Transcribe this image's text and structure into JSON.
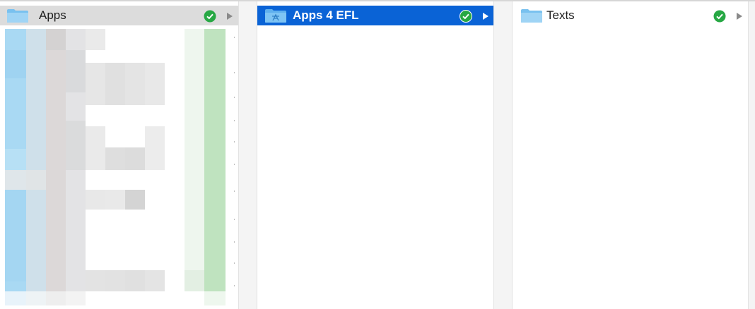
{
  "columns": [
    {
      "folder": {
        "name": "Apps",
        "state": "inactive-selected",
        "icon": "folder-icon",
        "status": "synced-check-icon",
        "arrow": "chevron-right-icon"
      },
      "contents": "pixelated-redacted-list"
    },
    {
      "folder": {
        "name": "Apps 4 EFL",
        "state": "active-selected",
        "icon": "app-folder-icon",
        "status": "synced-check-icon",
        "arrow": "chevron-right-icon"
      }
    },
    {
      "folder": {
        "name": "Texts",
        "state": "normal",
        "icon": "folder-icon",
        "status": "synced-check-icon",
        "arrow": "chevron-right-icon"
      }
    }
  ],
  "colors": {
    "selection_active": "#0a63d6",
    "selection_inactive": "#dcdcdc",
    "check_green": "#27a844",
    "folder_blue": "#79c1ef"
  }
}
